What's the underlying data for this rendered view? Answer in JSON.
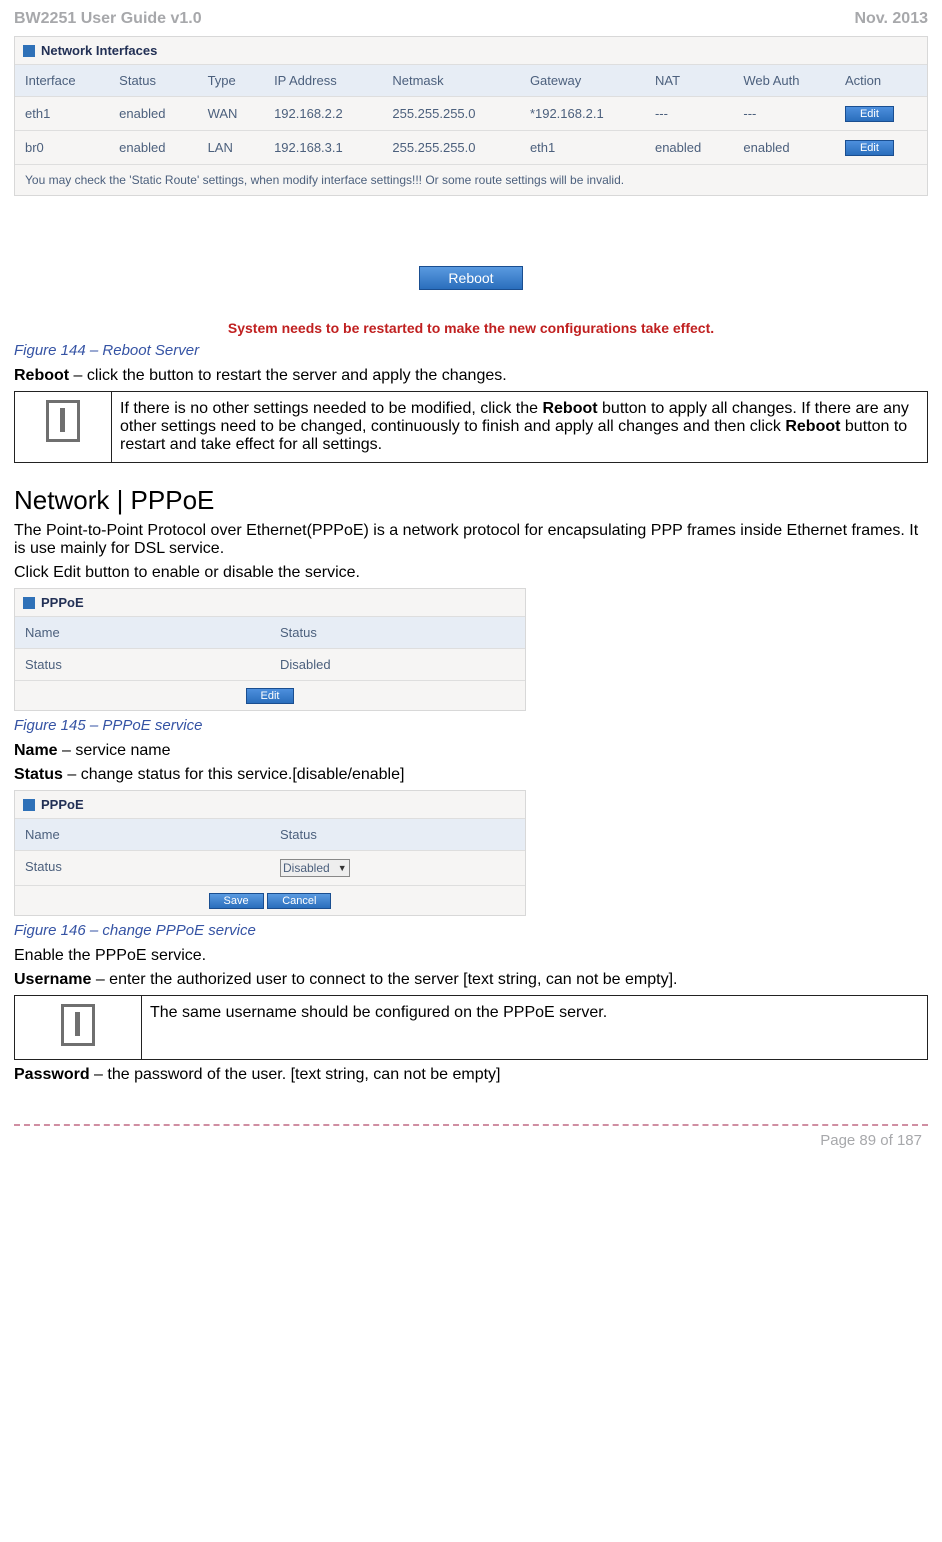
{
  "header": {
    "left": "BW2251 User Guide v1.0",
    "right": "Nov.  2013"
  },
  "ni_panel": {
    "title": "Network Interfaces",
    "cols": [
      "Interface",
      "Status",
      "Type",
      "IP Address",
      "Netmask",
      "Gateway",
      "NAT",
      "Web Auth",
      "Action"
    ],
    "rows": [
      {
        "c": [
          "eth1",
          "enabled",
          "WAN",
          "192.168.2.2",
          "255.255.255.0",
          "*192.168.2.1",
          "---",
          "---"
        ],
        "btn": "Edit"
      },
      {
        "c": [
          "br0",
          "enabled",
          "LAN",
          "192.168.3.1",
          "255.255.255.0",
          "eth1",
          "enabled",
          "enabled"
        ],
        "btn": "Edit"
      }
    ],
    "foot": "You may check the 'Static Route' settings, when modify interface settings!!! Or some route settings will be invalid."
  },
  "reboot": {
    "btn": "Reboot",
    "warn": "System needs to be restarted to make the new configurations take effect."
  },
  "fig144": "Figure 144 – Reboot Server",
  "reboot_line": {
    "b": "Reboot",
    "rest": " – click the button to restart the server and apply the changes."
  },
  "info1": {
    "pre": "If there is no other settings needed to be modified, click the ",
    "b1": "Reboot",
    "mid": " button to apply all changes. If there are any other settings need to be changed, continuously to finish and apply all changes and then click ",
    "b2": "Reboot",
    "post": " button to restart and take effect  for all settings."
  },
  "section": "Network | PPPoE",
  "sec_p1": "The Point-to-Point Protocol over Ethernet(PPPoE) is a network protocol for encapsulating PPP frames inside Ethernet frames. It is use mainly for DSL service.",
  "sec_p2": "Click Edit button to enable or disable the service.",
  "pppoe_panel_title": "PPPoE",
  "pppoe_head": {
    "c1": "Name",
    "c2": "Status"
  },
  "pppoe_row": {
    "c1": "Status",
    "c2": "Disabled"
  },
  "pppoe_edit_btn": "Edit",
  "fig145": "Figure 145 – PPPoE service",
  "name_line": {
    "b": "Name",
    "rest": " – service name"
  },
  "status_line": {
    "b": "Status",
    "rest": " – change status for this service.[disable/enable]"
  },
  "pppoe2_sel": "Disabled",
  "pppoe2_save": "Save",
  "pppoe2_cancel": "Cancel",
  "fig146": "Figure 146 – change PPPoE service",
  "enable_line": "Enable the PPPoE service.",
  "user_line": {
    "b": "Username",
    "rest": " – enter the authorized user to connect to the server [text string, can not be empty]."
  },
  "info2": "The same username should be configured on the PPPoE server.",
  "pass_line": {
    "b": "Password",
    "rest": " – the password of the user. [text string, can not be empty]"
  },
  "footer": "Page 89 of 187",
  "chart_data": {
    "type": "table",
    "title": "Network Interfaces",
    "columns": [
      "Interface",
      "Status",
      "Type",
      "IP Address",
      "Netmask",
      "Gateway",
      "NAT",
      "Web Auth"
    ],
    "rows": [
      [
        "eth1",
        "enabled",
        "WAN",
        "192.168.2.2",
        "255.255.255.0",
        "*192.168.2.1",
        "---",
        "---"
      ],
      [
        "br0",
        "enabled",
        "LAN",
        "192.168.3.1",
        "255.255.255.0",
        "eth1",
        "enabled",
        "enabled"
      ]
    ]
  }
}
